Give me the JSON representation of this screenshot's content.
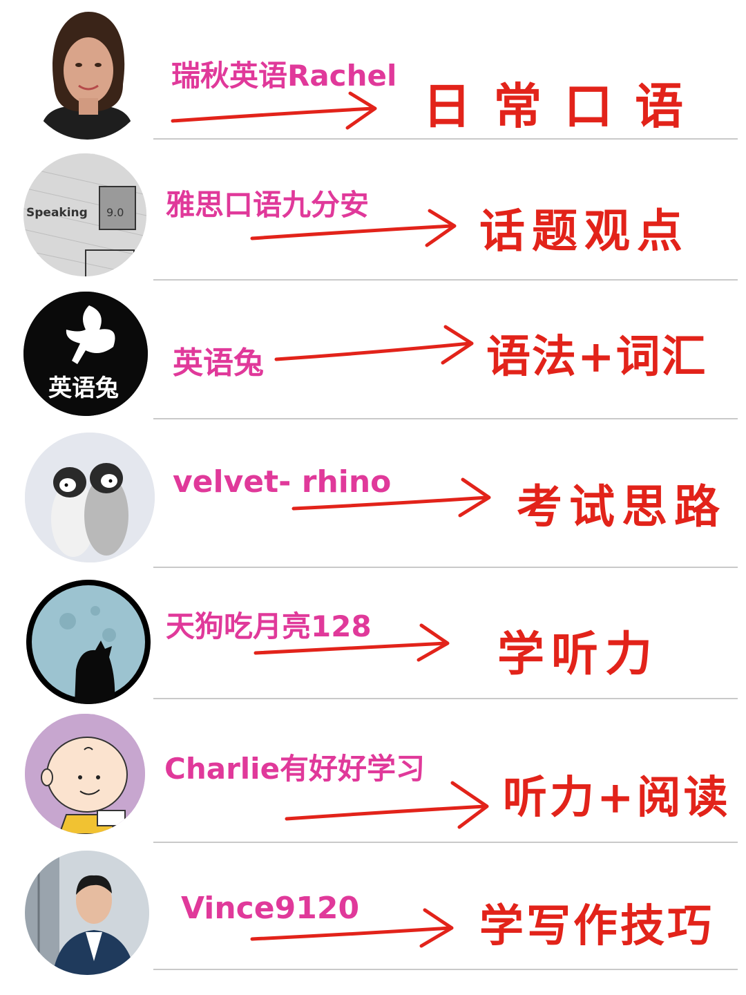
{
  "entries": [
    {
      "name": "瑞秋英语Rachel",
      "topic": "日 常 口 语",
      "avatar": "woman-portrait-avatar"
    },
    {
      "name": "雅思口语九分安",
      "topic": "话题观点",
      "avatar": "ielts-speaking-avatar",
      "avatar_text": [
        "Speaking",
        "9.0"
      ]
    },
    {
      "name": "英语兔",
      "topic": "语法+词汇",
      "avatar": "rabbit-logo-avatar",
      "avatar_text": [
        "英语兔"
      ]
    },
    {
      "name": "velvet- rhino",
      "topic": "考试思路",
      "avatar": "penguins-avatar"
    },
    {
      "name": "天狗吃月亮128",
      "topic": "学听力",
      "avatar": "moon-dog-avatar"
    },
    {
      "name": "Charlie有好好学习",
      "topic": "听力+阅读",
      "avatar": "charlie-brown-avatar"
    },
    {
      "name": "Vince9120",
      "topic": "学写作技巧",
      "avatar": "man-portrait-avatar"
    }
  ],
  "colors": {
    "name": "#e0399a",
    "topic": "#e2231a",
    "arrow": "#e2231a",
    "divider": "#c9c9c9"
  }
}
